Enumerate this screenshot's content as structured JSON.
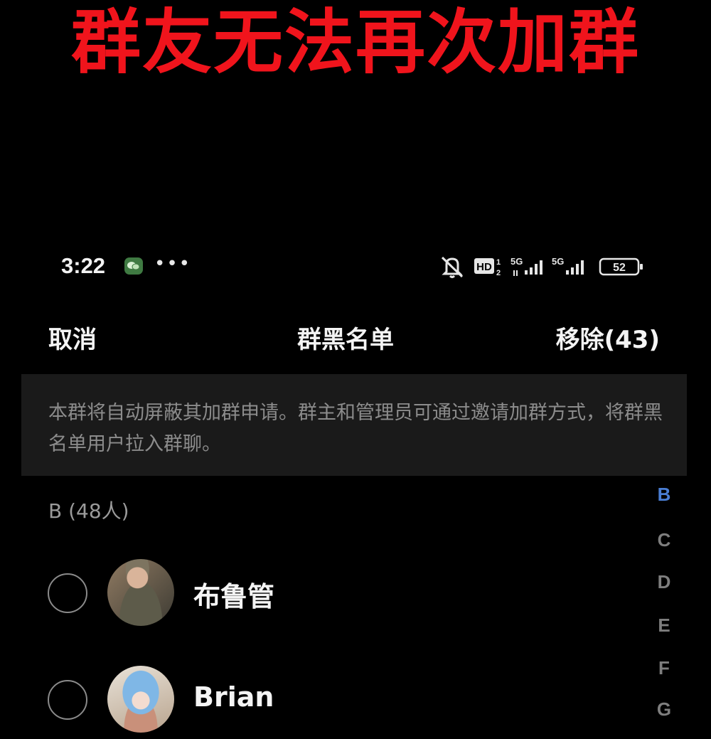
{
  "banner": {
    "title": "群友无法再次加群"
  },
  "status_bar": {
    "time": "3:22",
    "hd_badge": "HD",
    "hd_sub": "1",
    "hd_sub2": "2",
    "network1": "5G",
    "network2": "5G",
    "battery": "52",
    "icons": [
      "wechat-icon",
      "more-dots-icon",
      "mute-bell-icon",
      "hd-voice-icon",
      "signal-5g-icon",
      "signal-5g-icon",
      "battery-icon"
    ]
  },
  "navbar": {
    "cancel": "取消",
    "title": "群黑名单",
    "remove": "移除(43)"
  },
  "notice": "本群将自动屏蔽其加群申请。群主和管理员可通过邀请加群方式，将群黑名单用户拉入群聊。",
  "section": {
    "header": "B (48人)"
  },
  "contacts": [
    {
      "name": "布鲁管"
    },
    {
      "name": "Brian"
    }
  ],
  "index_letters": [
    "B",
    "C",
    "D",
    "E",
    "F",
    "G"
  ],
  "colors": {
    "banner": "#f0141c",
    "index_active": "#4a7ed4",
    "notice_bg": "#1a1a1a"
  }
}
